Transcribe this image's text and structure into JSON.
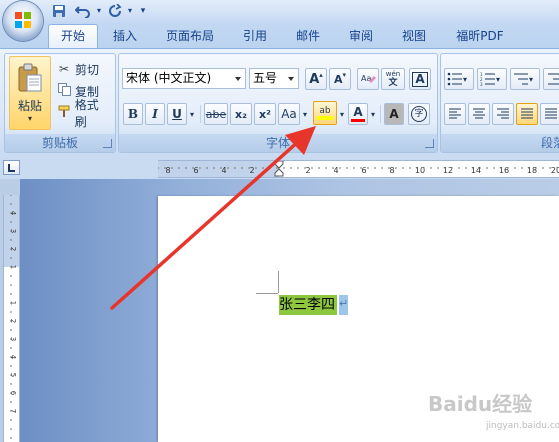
{
  "quick_access": {
    "save_icon": "save-icon",
    "undo_icon": "undo-icon",
    "redo_icon": "redo-icon",
    "customize_icon": "customize-qat-icon"
  },
  "tabs": [
    {
      "label": "开始",
      "active": true
    },
    {
      "label": "插入"
    },
    {
      "label": "页面布局"
    },
    {
      "label": "引用"
    },
    {
      "label": "邮件"
    },
    {
      "label": "审阅"
    },
    {
      "label": "视图"
    },
    {
      "label": "福昕PDF"
    }
  ],
  "clipboard": {
    "group_label": "剪贴板",
    "paste_label": "粘贴",
    "cut_label": "剪切",
    "copy_label": "复制",
    "format_painter_label": "格式刷"
  },
  "font": {
    "group_label": "字体",
    "font_name": "宋体 (中文正文)",
    "font_size": "五号",
    "grow_label": "A",
    "shrink_label": "A",
    "phonetic_label": "wén",
    "bold": "B",
    "italic": "I",
    "underline": "U",
    "strike": "abe",
    "subscript": "x₂",
    "superscript": "x²",
    "change_case": "Aa",
    "highlight_label": "ab",
    "highlight_color": "#ffff00",
    "font_color_label": "A",
    "font_color": "#ff0000",
    "shading_label": "A",
    "enclose_label": "字"
  },
  "paragraph": {
    "group_label": "段落"
  },
  "ruler": {
    "h_ticks": [
      "8",
      "6",
      "4",
      "2",
      "2",
      "4",
      "6",
      "8",
      "10",
      "12",
      "14",
      "16",
      "18",
      "20"
    ],
    "v_ticks": [
      "4",
      "3",
      "2",
      "1",
      "1",
      "2",
      "3",
      "4",
      "5",
      "6",
      "7"
    ]
  },
  "document": {
    "text": "张三李四",
    "para_mark": "↵"
  },
  "watermark": {
    "brand": "Baidu经验",
    "sub": "jingyan.baidu.com"
  },
  "colors": {
    "annotation_arrow": "#e8352b",
    "text_highlight": "#8dc63f"
  }
}
